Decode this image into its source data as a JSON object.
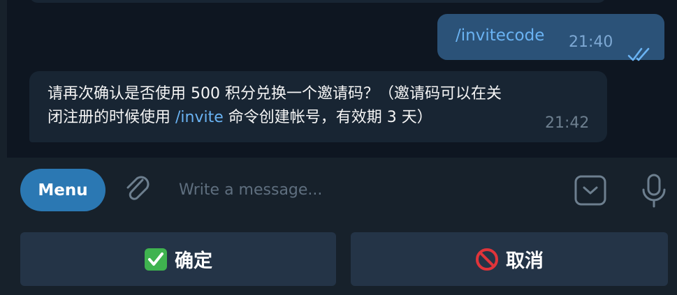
{
  "chat": {
    "outgoing": {
      "text": "/invitecode",
      "time": "21:40",
      "status_icon": "double-check-icon"
    },
    "incoming": {
      "line1": "请再次确认是否使用 500 积分兑换一个邀请码？（邀请码可以在关",
      "line2_before": "闭注册的时候使用 ",
      "command": "/invite",
      "line2_after": " 命令创建帐号，有效期 3 天）",
      "time": "21:42"
    }
  },
  "composer": {
    "menu_label": "Menu",
    "placeholder": "Write a message...",
    "value": ""
  },
  "keyboard": {
    "confirm": {
      "emoji": "check-mark-button-icon",
      "label": "确定"
    },
    "cancel": {
      "emoji": "prohibited-icon",
      "label": "取消"
    }
  },
  "colors": {
    "background": "#0e1621",
    "panel": "#17212b",
    "outgoing_bubble": "#2b5278",
    "incoming_bubble": "#182533",
    "accent": "#2b78b3",
    "link": "#6ab3f3",
    "keyboard_button": "#243447"
  }
}
